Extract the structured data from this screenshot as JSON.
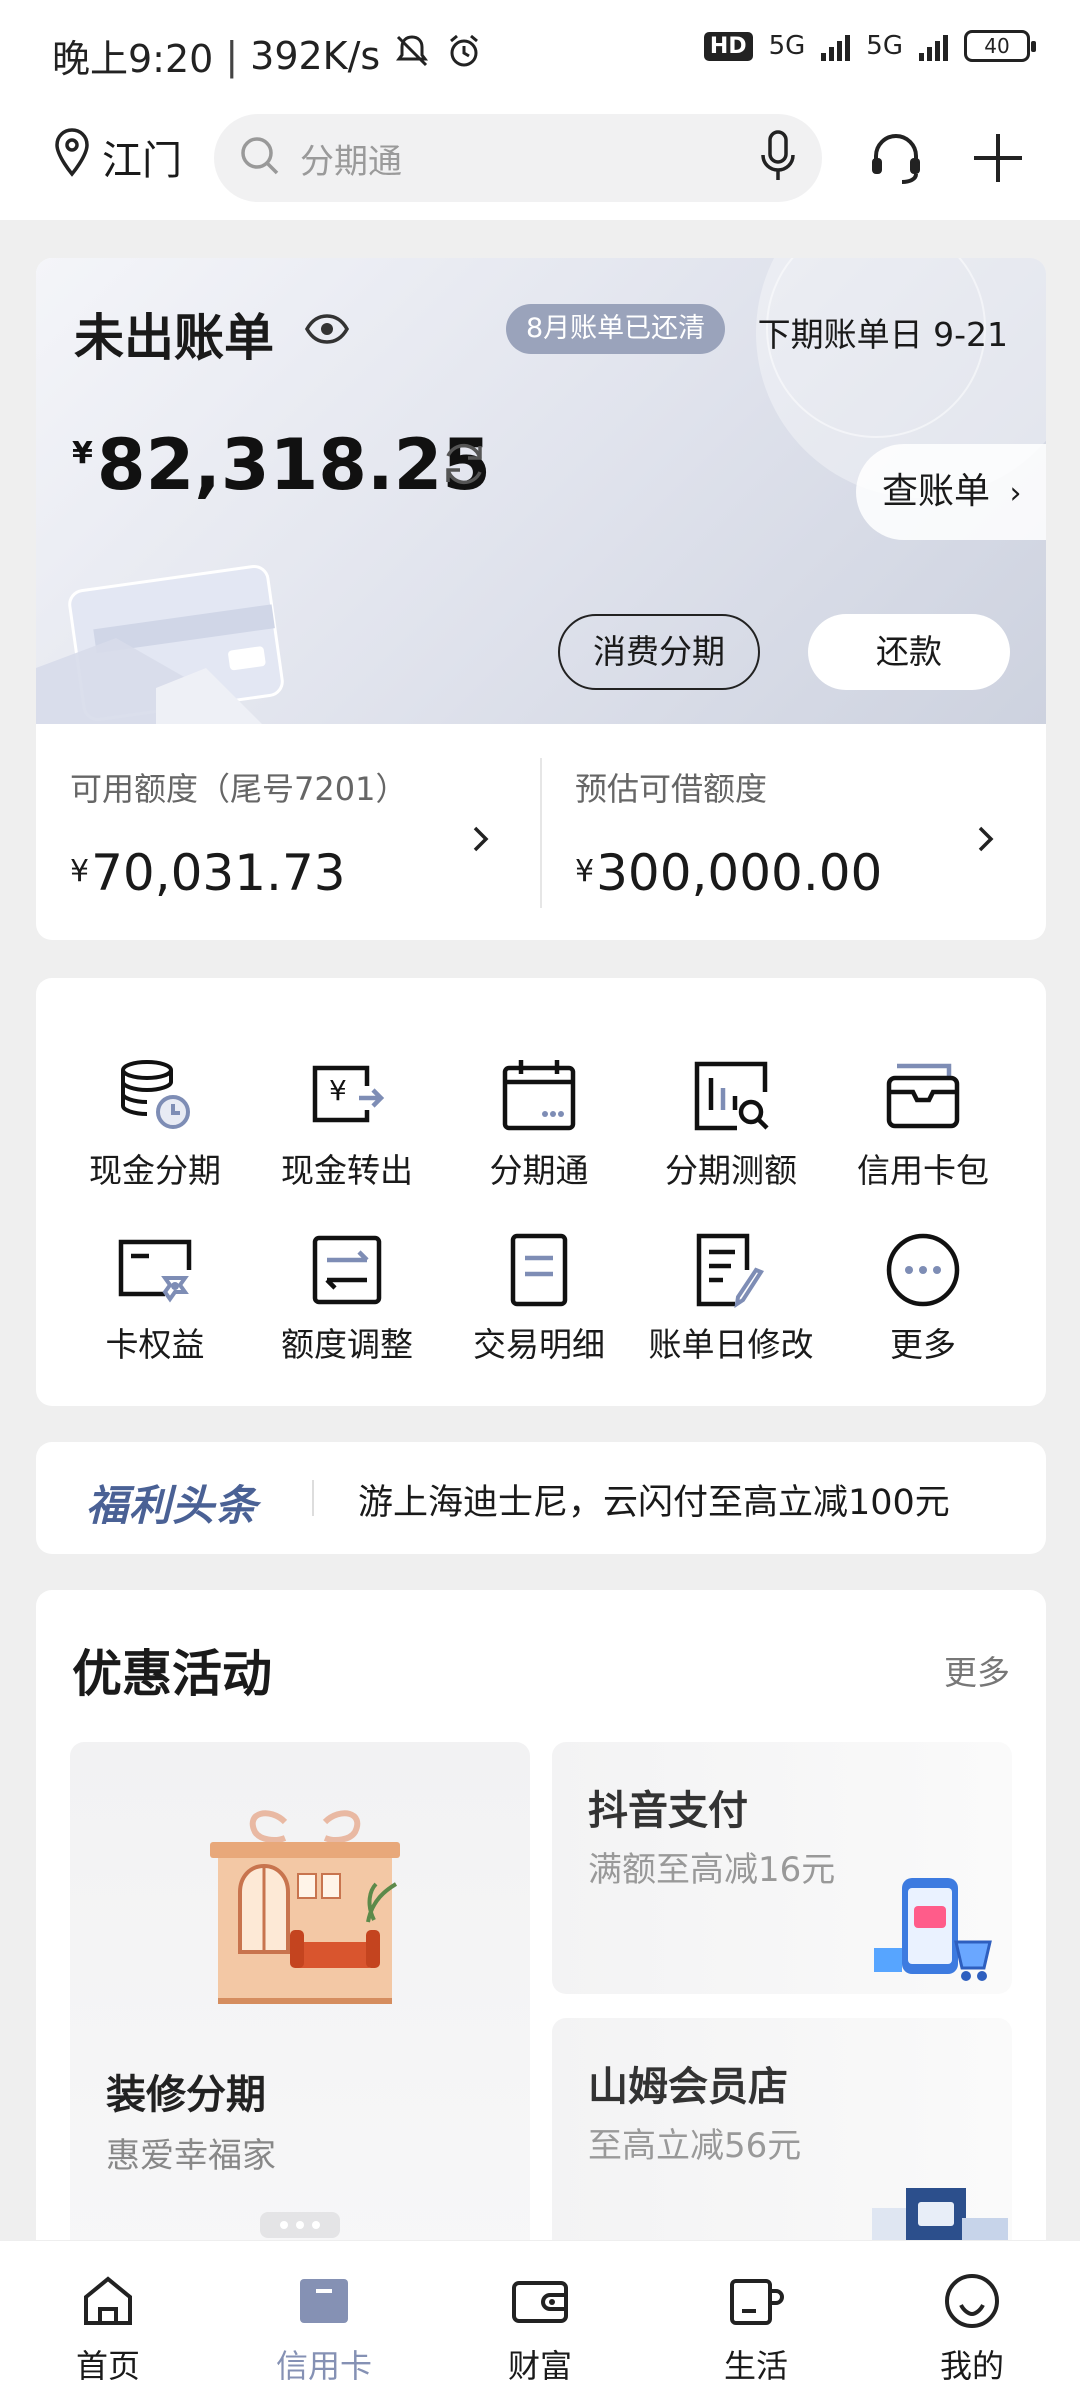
{
  "status_bar": {
    "time": "晚上9:20",
    "speed": "392K/s",
    "hd": "HD",
    "net1": "5G",
    "net2": "5G",
    "battery": "40"
  },
  "top_nav": {
    "location": "江门",
    "search_placeholder": "分期通"
  },
  "bill": {
    "title": "未出账单",
    "badge": "8月账单已还清",
    "next_bill_date": "下期账单日  9-21",
    "currency": "¥",
    "amount": "82,318.25",
    "view_bill": "查账单",
    "installment_btn": "消费分期",
    "repay_btn": "还款",
    "available": {
      "label": "可用额度（尾号7201）",
      "currency": "¥",
      "value": "70,031.73"
    },
    "loan": {
      "label": "预估可借额度",
      "currency": "¥",
      "value": "300,000.00"
    }
  },
  "quick_actions": [
    {
      "label": "现金分期",
      "icon": "coins-stack-icon"
    },
    {
      "label": "现金转出",
      "icon": "cash-transfer-icon"
    },
    {
      "label": "分期通",
      "icon": "calendar-icon"
    },
    {
      "label": "分期测额",
      "icon": "chart-search-icon"
    },
    {
      "label": "信用卡包",
      "icon": "card-wallet-icon"
    },
    {
      "label": "卡权益",
      "icon": "card-benefit-icon"
    },
    {
      "label": "额度调整",
      "icon": "limit-adjust-icon"
    },
    {
      "label": "交易明细",
      "icon": "document-icon"
    },
    {
      "label": "账单日修改",
      "icon": "edit-document-icon"
    },
    {
      "label": "更多",
      "icon": "more-dots-icon"
    }
  ],
  "news": {
    "brand": "福利头条",
    "text": "游上海迪士尼，云闪付至高立减100元"
  },
  "promotions": {
    "title": "优惠活动",
    "more": "更多",
    "big_card": {
      "title": "装修分期",
      "subtitle": "惠爱幸福家"
    },
    "card1": {
      "title": "抖音支付",
      "subtitle": "满额至高减16元"
    },
    "card2": {
      "title": "山姆会员店",
      "subtitle": "至高立减56元"
    }
  },
  "tabs": [
    {
      "label": "首页",
      "icon": "home-icon"
    },
    {
      "label": "信用卡",
      "icon": "credit-card-icon"
    },
    {
      "label": "财富",
      "icon": "wallet-icon"
    },
    {
      "label": "生活",
      "icon": "cup-icon"
    },
    {
      "label": "我的",
      "icon": "smile-icon"
    }
  ],
  "colors": {
    "accent": "#8591b4",
    "badge_bg": "#9aa3bb",
    "news_brand": "#4a6195"
  }
}
